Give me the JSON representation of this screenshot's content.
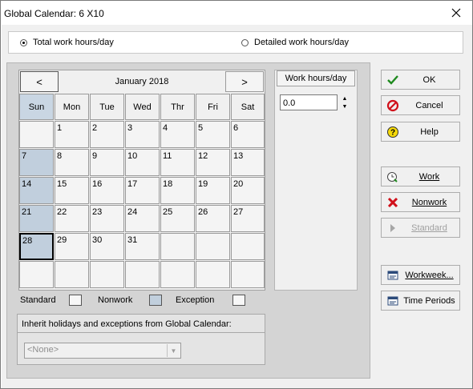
{
  "window": {
    "title": "Global Calendar: 6 X10"
  },
  "mode": {
    "total_label": "Total work hours/day",
    "detailed_label": "Detailed work hours/day",
    "selected": "total"
  },
  "calendar": {
    "month_label": "January 2018",
    "prev_label": "<",
    "next_label": ">",
    "weekdays": [
      "Sun",
      "Mon",
      "Tue",
      "Wed",
      "Thr",
      "Fri",
      "Sat"
    ],
    "weeks": [
      [
        "",
        "1",
        "2",
        "3",
        "4",
        "5",
        "6"
      ],
      [
        "7",
        "8",
        "9",
        "10",
        "11",
        "12",
        "13"
      ],
      [
        "14",
        "15",
        "16",
        "17",
        "18",
        "19",
        "20"
      ],
      [
        "21",
        "22",
        "23",
        "24",
        "25",
        "26",
        "27"
      ],
      [
        "28",
        "29",
        "30",
        "31",
        "",
        "",
        ""
      ],
      [
        "",
        "",
        "",
        "",
        "",
        "",
        ""
      ]
    ],
    "selected_day": "28"
  },
  "work_hours": {
    "title": "Work hours/day",
    "value": "0.0"
  },
  "legend": {
    "standard": "Standard",
    "nonwork": "Nonwork",
    "exception": "Exception"
  },
  "inherit": {
    "label": "Inherit holidays and exceptions from Global Calendar:",
    "value": "<None>"
  },
  "buttons": {
    "ok": "OK",
    "cancel": "Cancel",
    "help": "Help",
    "work": "Work",
    "nonwork": "Nonwork",
    "standard": "Standard",
    "workweek": "Workweek...",
    "time_periods": "Time Periods"
  },
  "colors": {
    "sunday": "#c1cfdd",
    "ok_check": "#1f8a1f",
    "cancel_red": "#d0101a"
  }
}
